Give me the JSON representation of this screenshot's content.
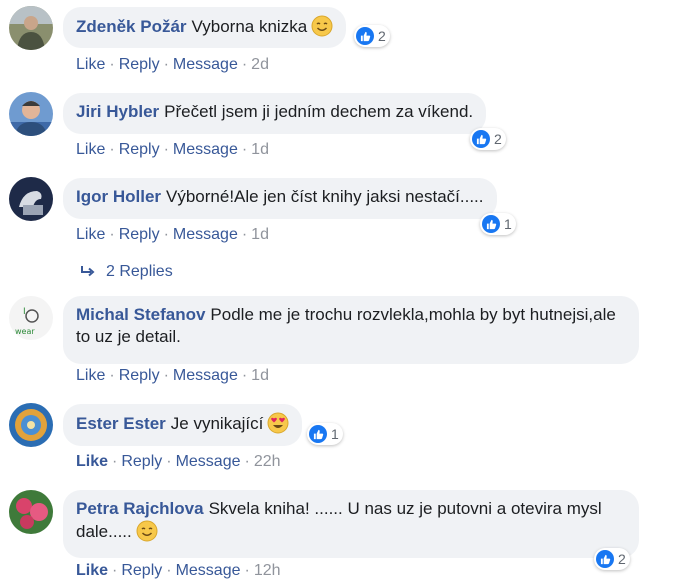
{
  "colors": {
    "link": "#385898",
    "meta": "#90949c",
    "bubble": "#f0f2f5",
    "like_blue": "#1877f2"
  },
  "actions": {
    "like": "Like",
    "reply": "Reply",
    "message": "Message",
    "sep": "·"
  },
  "comments": [
    {
      "author": "Zdeněk Požár",
      "text": "Vyborna knizka",
      "emoji": "smile-emoji",
      "reactions": "2",
      "time": "2d",
      "like_bold": false
    },
    {
      "author": "Jiri Hybler",
      "text": "Přečetl jsem ji jedním dechem za víkend.",
      "reactions": "2",
      "time": "1d",
      "like_bold": false
    },
    {
      "author": "Igor Holler",
      "text": "Výborné!Ale jen číst knihy jaksi nestačí.....",
      "reactions": "1",
      "time": "1d",
      "like_bold": false
    },
    {
      "author": "Michal Stefanov",
      "text": "Podle me je trochu rozvlekla,mohla by byt hutnejsi,ale to uz je detail.",
      "reactions": "",
      "time": "1d",
      "like_bold": false
    },
    {
      "author": "Ester Ester",
      "text": "Je vynikající",
      "emoji": "heart-eyes-emoji",
      "reactions": "1",
      "time": "22h",
      "like_bold": true
    },
    {
      "author": "Petra Rajchlova",
      "text": "Skvela kniha! ...... U nas uz je putovni a otevira mysl dale.....",
      "emoji": "smile-emoji",
      "reactions": "2",
      "time": "12h",
      "like_bold": true
    }
  ],
  "replies_link": "2 Replies"
}
